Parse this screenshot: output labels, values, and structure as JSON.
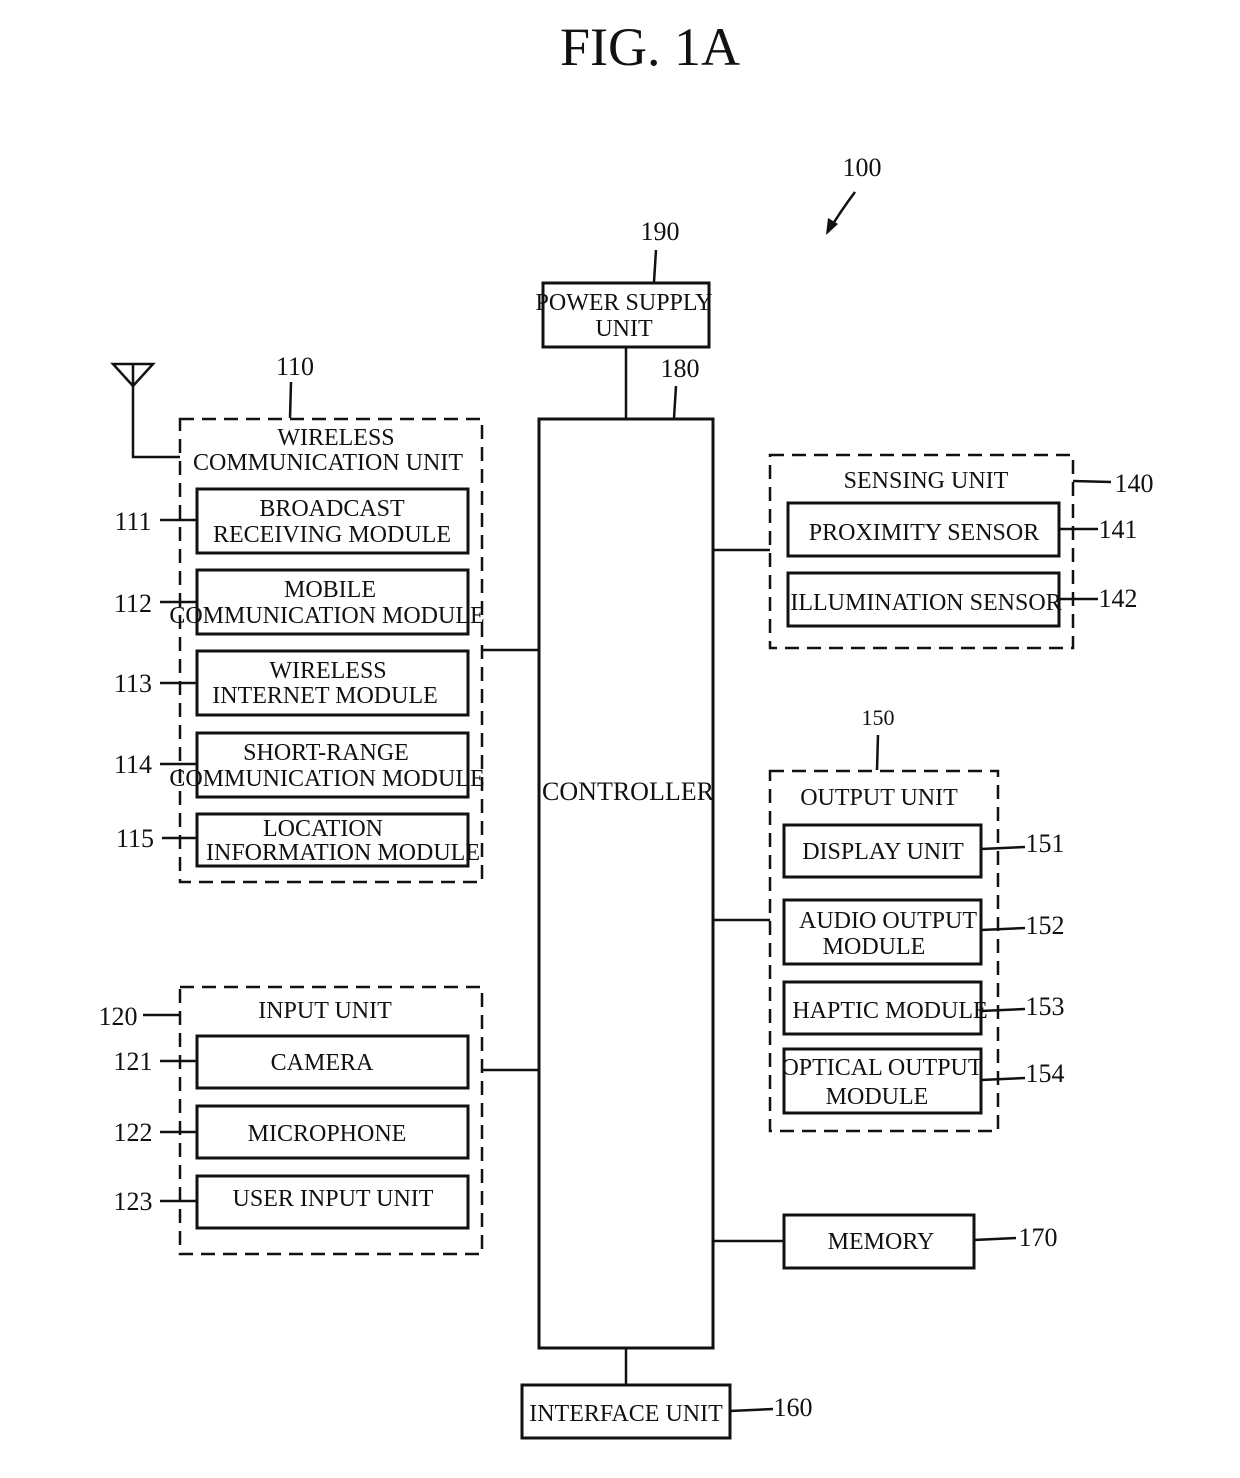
{
  "figure": {
    "title": "FIG. 1A",
    "ref": "100"
  },
  "power": {
    "label_1": "POWER SUPPLY",
    "label_2": "UNIT",
    "ref": "190"
  },
  "controller": {
    "label": "CONTROLLER",
    "ref": "180"
  },
  "wireless": {
    "title_1": "WIRELESS",
    "title_2": "COMMUNICATION UNIT",
    "ref": "110",
    "modules": [
      {
        "line1": "BROADCAST",
        "line2": "RECEIVING MODULE",
        "ref": "111"
      },
      {
        "line1": "MOBILE",
        "line2": "COMMUNICATION MODULE",
        "ref": "112"
      },
      {
        "line1": "WIRELESS",
        "line2": "INTERNET MODULE",
        "ref": "113"
      },
      {
        "line1": "SHORT-RANGE",
        "line2": "COMMUNICATION MODULE",
        "ref": "114"
      },
      {
        "line1": "LOCATION",
        "line2": "INFORMATION MODULE",
        "ref": "115"
      }
    ]
  },
  "input": {
    "title": "INPUT UNIT",
    "ref": "120",
    "modules": [
      {
        "label": "CAMERA",
        "ref": "121"
      },
      {
        "label": "MICROPHONE",
        "ref": "122"
      },
      {
        "label": "USER INPUT UNIT",
        "ref": "123"
      }
    ]
  },
  "sensing": {
    "title": "SENSING UNIT",
    "ref": "140",
    "modules": [
      {
        "label": "PROXIMITY SENSOR",
        "ref": "141"
      },
      {
        "label": "ILLUMINATION SENSOR",
        "ref": "142"
      }
    ]
  },
  "output": {
    "title": "OUTPUT UNIT",
    "ref": "150",
    "modules": [
      {
        "line1": "DISPLAY UNIT",
        "line2": "",
        "ref": "151"
      },
      {
        "line1": "AUDIO OUTPUT",
        "line2": "MODULE",
        "ref": "152"
      },
      {
        "line1": "HAPTIC MODULE",
        "line2": "",
        "ref": "153"
      },
      {
        "line1": "OPTICAL OUTPUT",
        "line2": "MODULE",
        "ref": "154"
      }
    ]
  },
  "memory": {
    "label": "MEMORY",
    "ref": "170"
  },
  "interface": {
    "label": "INTERFACE UNIT",
    "ref": "160"
  }
}
